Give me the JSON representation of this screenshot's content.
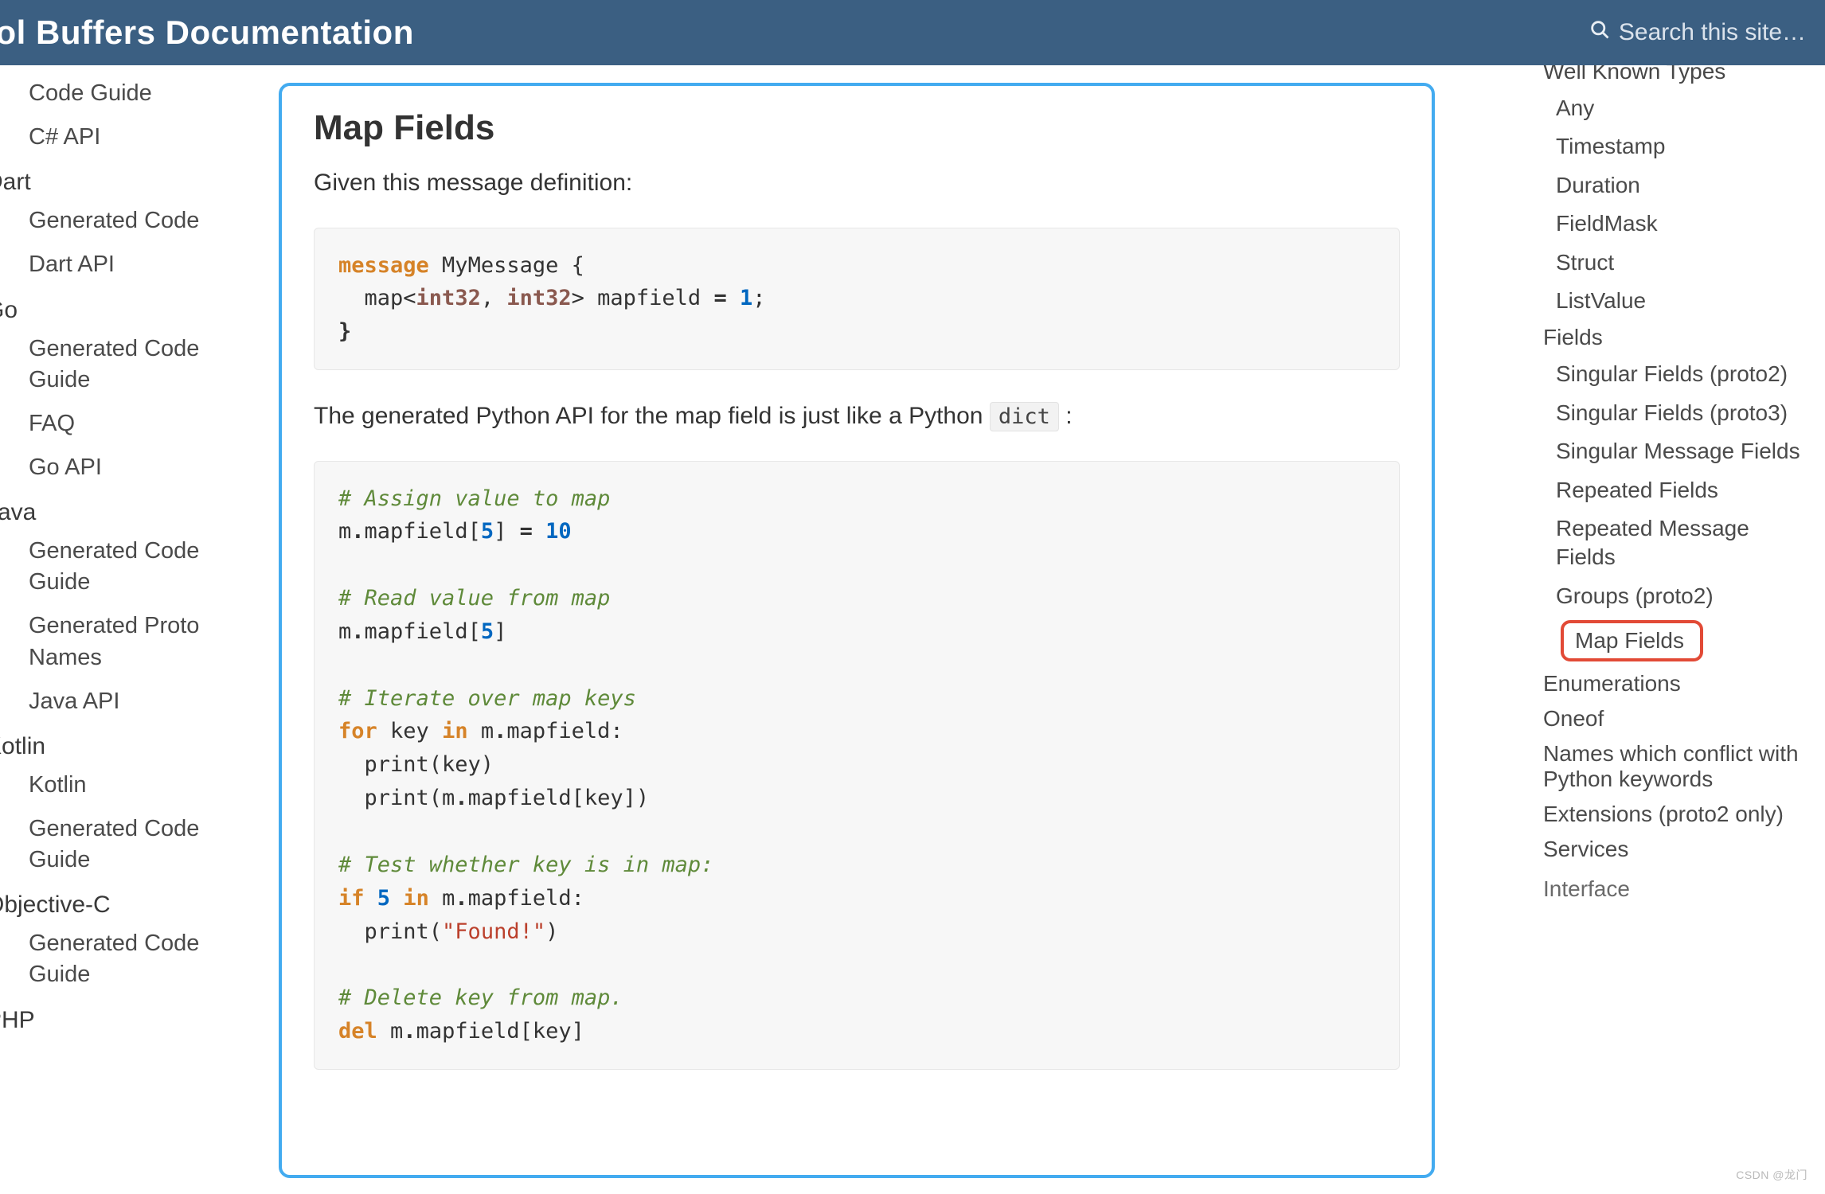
{
  "header": {
    "title": "tocol Buffers Documentation",
    "search_placeholder": "Search this site…"
  },
  "left_nav": [
    {
      "type": "item",
      "label": "Code Guide"
    },
    {
      "type": "item",
      "label": "C# API"
    },
    {
      "type": "group",
      "label": "Dart"
    },
    {
      "type": "item",
      "label": "Generated Code"
    },
    {
      "type": "item",
      "label": "Dart API"
    },
    {
      "type": "group",
      "label": "Go"
    },
    {
      "type": "item",
      "label": "Generated Code Guide"
    },
    {
      "type": "item",
      "label": "FAQ"
    },
    {
      "type": "item",
      "label": "Go API"
    },
    {
      "type": "group",
      "label": "Java"
    },
    {
      "type": "item",
      "label": "Generated Code Guide"
    },
    {
      "type": "item",
      "label": "Generated Proto Names"
    },
    {
      "type": "item",
      "label": "Java API"
    },
    {
      "type": "group",
      "label": "Kotlin"
    },
    {
      "type": "item",
      "label": "Kotlin"
    },
    {
      "type": "item",
      "label": "Generated Code Guide"
    },
    {
      "type": "group",
      "label": "Objective-C"
    },
    {
      "type": "item",
      "label": "Generated Code Guide"
    },
    {
      "type": "group",
      "label": "PHP"
    }
  ],
  "content": {
    "title": "Map Fields",
    "p1": "Given this message definition:",
    "code1": {
      "l1_kw": "message",
      "l1_rest": " MyMessage {",
      "l2_pre": "  map<",
      "l2_ty1": "int32",
      "l2_mid": ", ",
      "l2_ty2": "int32",
      "l2_post": "> mapfield ",
      "l2_eq": "=",
      "l2_num": " 1",
      "l2_end": ";",
      "l3": "}"
    },
    "p2_pre": "The generated Python API for the map field is just like a Python ",
    "p2_code": "dict",
    "p2_post": " :",
    "code2": {
      "c1": "# Assign value to map",
      "l1_pre": "m",
      "l1_dot": ".",
      "l1_mid": "mapfield[",
      "l1_num": "5",
      "l1_post": "] ",
      "l1_eq": "=",
      "l1_val": " 10",
      "c2": "# Read value from map",
      "l2_pre": "m",
      "l2_dot": ".",
      "l2_mid": "mapfield[",
      "l2_num": "5",
      "l2_post": "]",
      "c3": "# Iterate over map keys",
      "l3_for": "for",
      "l3_mid1": " key ",
      "l3_in": "in",
      "l3_mid2": " m",
      "l3_dot": ".",
      "l3_post": "mapfield:",
      "l4": "  print(key)",
      "l5_pre": "  print(m",
      "l5_dot": ".",
      "l5_post": "mapfield[key])",
      "c4": "# Test whether key is in map:",
      "l6_if": "if",
      "l6_sp": " ",
      "l6_num": "5",
      "l6_sp2": " ",
      "l6_in": "in",
      "l6_mid": " m",
      "l6_dot": ".",
      "l6_post": "mapfield:",
      "l7_pre": "  print(",
      "l7_str": "\"Found!\"",
      "l7_post": ")",
      "c5": "# Delete key from map.",
      "l8_del": "del",
      "l8_mid": " m",
      "l8_dot": ".",
      "l8_post": "mapfield[key]"
    }
  },
  "right_nav": {
    "top_cut": "Well Known Types",
    "items": [
      {
        "lvl": 2,
        "label": "Any"
      },
      {
        "lvl": 2,
        "label": "Timestamp"
      },
      {
        "lvl": 2,
        "label": "Duration"
      },
      {
        "lvl": 2,
        "label": "FieldMask"
      },
      {
        "lvl": 2,
        "label": "Struct"
      },
      {
        "lvl": 2,
        "label": "ListValue"
      },
      {
        "lvl": 1,
        "label": "Fields"
      },
      {
        "lvl": 2,
        "label": "Singular Fields (proto2)"
      },
      {
        "lvl": 2,
        "label": "Singular Fields (proto3)"
      },
      {
        "lvl": 2,
        "label": "Singular Message Fields"
      },
      {
        "lvl": 2,
        "label": "Repeated Fields"
      },
      {
        "lvl": 2,
        "label": "Repeated Message Fields"
      },
      {
        "lvl": 2,
        "label": "Groups (proto2)"
      },
      {
        "lvl": 2,
        "label": "Map Fields",
        "highlight": true
      },
      {
        "lvl": 1,
        "label": "Enumerations"
      },
      {
        "lvl": 1,
        "label": "Oneof"
      },
      {
        "lvl": 1,
        "label": "Names which conflict with Python keywords"
      },
      {
        "lvl": 1,
        "label": "Extensions (proto2 only)"
      },
      {
        "lvl": 1,
        "label": "Services"
      }
    ],
    "bottom_cut": "Interface"
  },
  "watermark": "CSDN @龙门"
}
